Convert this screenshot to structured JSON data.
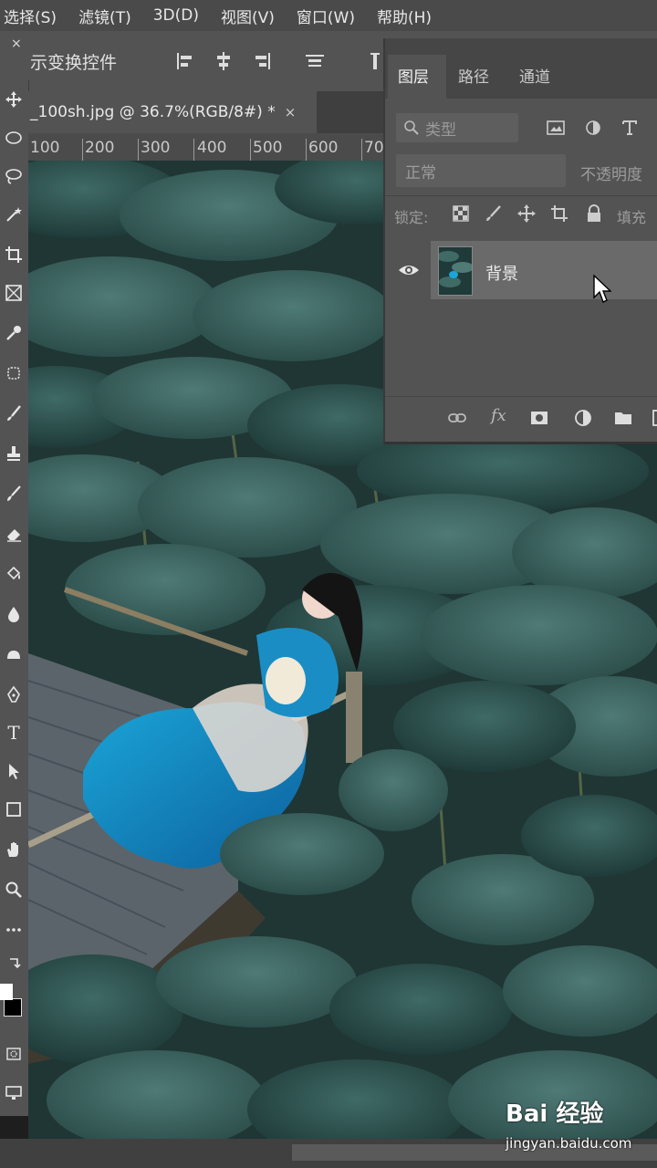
{
  "menubar": {
    "items": [
      "选择(S)",
      "滤镜(T)",
      "3D(D)",
      "视图(V)",
      "窗口(W)",
      "帮助(H)"
    ]
  },
  "options": {
    "label": "示变换控件",
    "close_glyph": "×"
  },
  "document": {
    "tab_title": "_100sh.jpg @ 36.7%(RGB/8#) *",
    "close_glyph": "×"
  },
  "ruler": {
    "labels": [
      "100",
      "200",
      "300",
      "400",
      "500",
      "600",
      "70"
    ]
  },
  "layers_panel": {
    "tabs": [
      {
        "label": "图层",
        "active": true
      },
      {
        "label": "路径",
        "active": false
      },
      {
        "label": "通道",
        "active": false
      }
    ],
    "filter_placeholder": "类型",
    "blend_mode": "正常",
    "opacity_label": "不透明度",
    "lock_label": "锁定:",
    "fill_label": "填充",
    "layer": {
      "name": "背景",
      "visible": true
    },
    "bottom_icons": [
      "link-icon",
      "fx-icon",
      "mask-icon",
      "adjustment-icon",
      "folder-icon",
      "new-layer-icon"
    ],
    "fx_label": "fx"
  },
  "toolbar": {
    "type_tool_label": "T"
  },
  "watermark": {
    "brand": "Bai 经验",
    "url": "jingyan.baidu.com"
  },
  "colors": {
    "menu_bg": "#4a4a4a",
    "panel_bg": "#535353",
    "canvas_teal": "#27413f"
  }
}
